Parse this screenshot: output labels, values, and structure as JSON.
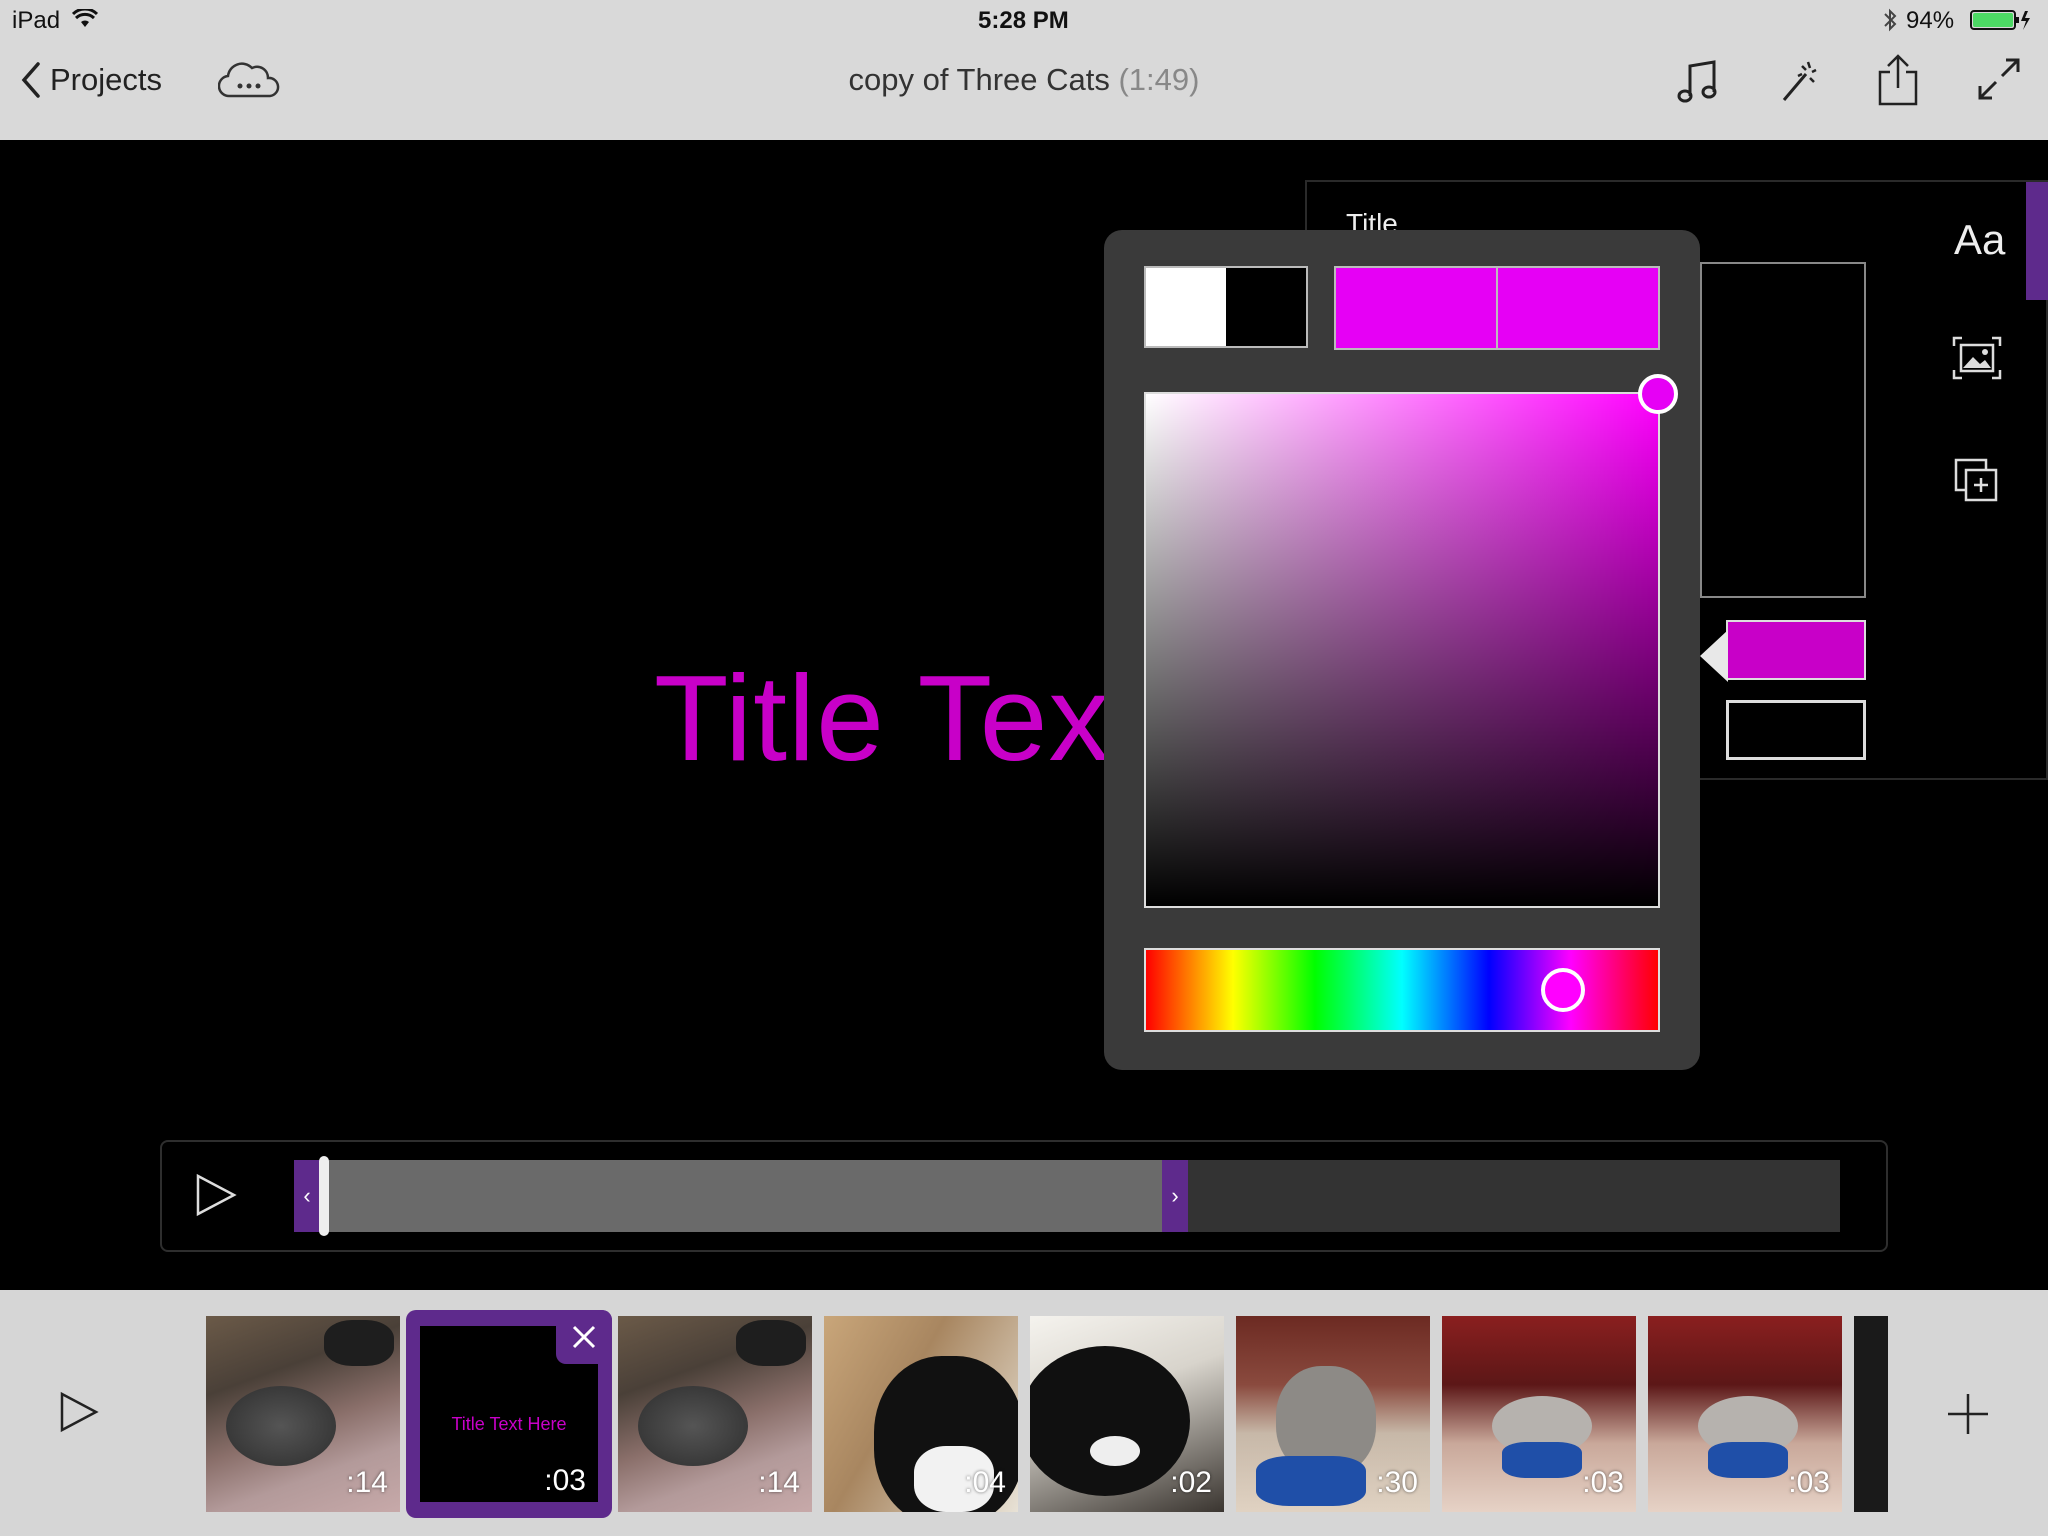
{
  "status": {
    "device": "iPad",
    "time": "5:28 PM",
    "battery": "94%"
  },
  "nav": {
    "back_label": "Projects",
    "title": "copy of Three Cats",
    "duration": "(1:49)",
    "icons": [
      "cloud-icon",
      "music-icon",
      "magic-wand-icon",
      "share-icon",
      "fullscreen-icon"
    ]
  },
  "preview": {
    "title_text": "Title Text",
    "title_color": "#c800c8"
  },
  "inspector": {
    "label": "Title",
    "accent": "#5e2a8c"
  },
  "color_picker": {
    "presets": [
      "#ffffff",
      "#000000"
    ],
    "current_color": "#e600f5",
    "previous_color": "#e600f5",
    "hue_hex": "#ff00ff",
    "text_color_swatch": "#c800c8",
    "background_color_swatch": "#000000"
  },
  "playbar": {
    "progress": 0.55
  },
  "clips": [
    {
      "type": "photo",
      "duration": ":14"
    },
    {
      "type": "title",
      "label": "Title Text Here",
      "duration": ":03",
      "selected": true
    },
    {
      "type": "photo",
      "duration": ":14"
    },
    {
      "type": "photo",
      "duration": ":04"
    },
    {
      "type": "photo",
      "duration": ":02"
    },
    {
      "type": "photo",
      "duration": ":30"
    },
    {
      "type": "photo",
      "duration": ":03"
    },
    {
      "type": "photo",
      "duration": ":03"
    }
  ]
}
